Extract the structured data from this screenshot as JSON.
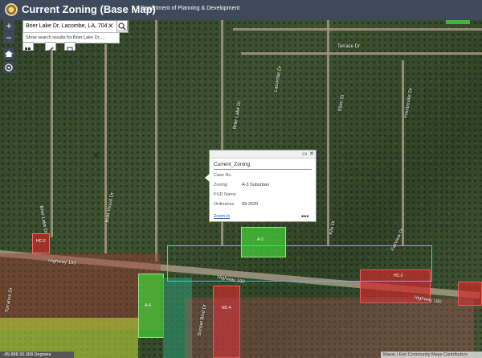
{
  "header": {
    "title": "Current Zoning (Base Map)",
    "department": "Department of Planning & Development"
  },
  "controls": {
    "zoom_in": "+",
    "zoom_out": "−",
    "search_value": "Brier Lake Dr, Lacombe, LA, 704",
    "search_suggestion": "Show search results for Brier Lake Dr, ..."
  },
  "popup": {
    "title": "Current_Zoning",
    "rows": [
      {
        "label": "Case No.",
        "value": ""
      },
      {
        "label": "Zoning",
        "value": "A-3 Suburban"
      },
      {
        "label": "PUD Name",
        "value": ""
      },
      {
        "label": "Ordinance",
        "value": "09-2020"
      }
    ],
    "zoom_link": "Zoom to",
    "more": "•••"
  },
  "map": {
    "street_labels": [
      "Brier Lake Dr",
      "Highway 190",
      "Highway 190",
      "Highway 190",
      "Fairview Dr",
      "Brier Lake Dr",
      "Torrance Dr",
      "Brier Wood Dr",
      "Sunset Blvd Dr",
      "Kilo Dr",
      "Ellen St",
      "Lacombe Dr",
      "Frentreville Dr",
      "Terrace Dr"
    ],
    "zone_labels": [
      "A-3",
      "HC-2",
      "A-4",
      "NC-4",
      "HC-2"
    ]
  },
  "footer": {
    "coords": "-89.888 30.308 Degrees",
    "attribution": "Maxar | Esri Community Maps Contributors"
  },
  "colors": {
    "header_bg": "#3e4a5c",
    "zone_red": "#cc2a2a",
    "zone_green": "#46c93a",
    "zone_yellowgreen": "#b5d23a",
    "zone_teal": "#2f8f6a",
    "boundary_cyan": "#37d0d8"
  }
}
